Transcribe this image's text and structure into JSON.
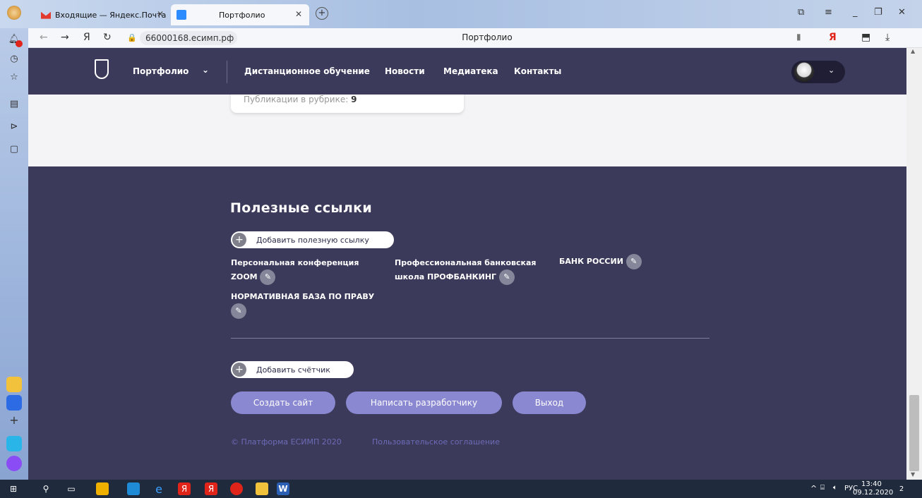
{
  "browser": {
    "tabs": [
      {
        "title": "Входящие — Яндекс.Почта",
        "active": false
      },
      {
        "title": "Портфолио",
        "active": true
      }
    ],
    "url": "66000168.есимп.рф",
    "page_title": "Портфолио",
    "yandex_letter": "Я",
    "colors": {
      "tab_strip": "#a8bfe2",
      "accent_red": "#e1241a"
    }
  },
  "site": {
    "nav": {
      "portfolio": "Портфолио",
      "items": [
        "Дистанционное обучение",
        "Новости",
        "Медиатека",
        "Контакты"
      ]
    },
    "card": {
      "label": "Публикации в рубрике:",
      "count": "9"
    },
    "footer": {
      "links_title": "Полезные ссылки",
      "add_link_label": "Добавить полезную ссылку",
      "links": [
        {
          "line1": "Персональная конференция",
          "line2": "ZOOM"
        },
        {
          "line1": "Профессиональная банковская",
          "line2": "школа ПРОФБАНКИНГ"
        },
        {
          "line1": "БАНК РОССИИ"
        },
        {
          "line1": "НОРМАТИВНАЯ БАЗА ПО ПРАВУ"
        }
      ],
      "add_counter_label": "Добавить счётчик",
      "buttons": {
        "create_site": "Создать сайт",
        "write_developer": "Написать разработчику",
        "logout": "Выход"
      },
      "copyright": "© Платформа ЕСИМП 2020",
      "agreement": "Пользовательское соглашение"
    },
    "colors": {
      "header_bg": "#3b3a5a",
      "button": "#8a88d0",
      "footer_link": "#6d6bb6"
    }
  },
  "taskbar": {
    "language": "РУС",
    "time": "13:40",
    "date": "09.12.2020",
    "notifications": "2"
  }
}
